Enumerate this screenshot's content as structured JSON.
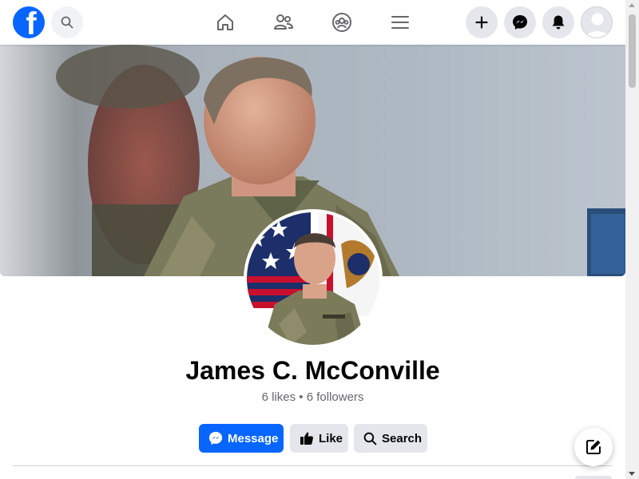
{
  "page": {
    "name": "James C. McConville",
    "likes": "6 likes",
    "separator": "•",
    "followers": "6 followers"
  },
  "actions": {
    "message_label": "Message",
    "like_label": "Like",
    "search_label": "Search"
  },
  "icons": {
    "logo": "facebook-logo",
    "search": "search-icon",
    "home": "home-icon",
    "friends": "friends-icon",
    "groups": "groups-icon",
    "menu": "menu-icon",
    "create": "plus-icon",
    "messenger": "messenger-icon",
    "notifications": "bell-icon",
    "account": "avatar",
    "compose": "compose-icon"
  },
  "colors": {
    "brand_blue": "#0866ff",
    "secondary_button": "#e4e6eb",
    "muted_text": "#65676b"
  }
}
